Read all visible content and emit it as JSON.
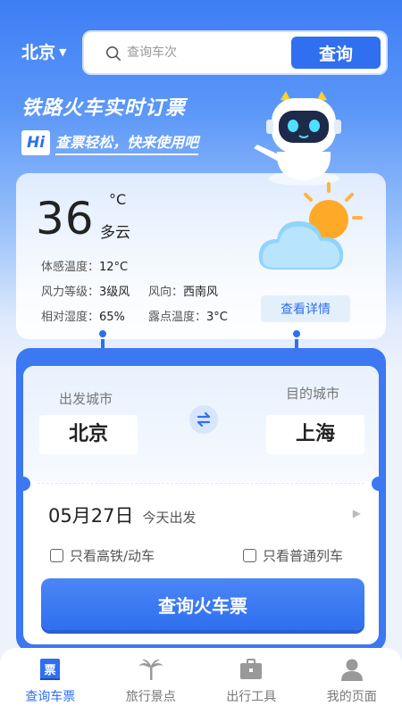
{
  "header": {
    "city": "北京",
    "search_placeholder": "查询车次",
    "search_button": "查询"
  },
  "banner": {
    "title": "铁路火车实时订票",
    "hi": "Hi",
    "subtitle": "查票轻松，快来使用吧"
  },
  "weather": {
    "temperature": "36",
    "unit": "°C",
    "condition": "多云",
    "feels_like_label": "体感温度：",
    "feels_like": "12°C",
    "wind_level_label": "风力等级：",
    "wind_level": "3级风",
    "wind_dir_label": "风向：",
    "wind_dir": "西南风",
    "humidity_label": "相对湿度：",
    "humidity": "65%",
    "dew_label": "露点温度：",
    "dew": "3°C",
    "detail_button": "查看详情"
  },
  "ticket": {
    "from_label": "出发城市",
    "to_label": "目的城市",
    "from_city": "北京",
    "to_city": "上海",
    "date": "05月27日",
    "date_sub": "今天出发",
    "only_high_speed": "只看高铁/动车",
    "only_regular": "只看普通列车",
    "query_button": "查询火车票"
  },
  "nav": [
    {
      "label": "查询车票",
      "icon": "ticket-icon",
      "active": true
    },
    {
      "label": "旅行景点",
      "icon": "palm-tree-icon",
      "active": false
    },
    {
      "label": "出行工具",
      "icon": "briefcase-icon",
      "active": false
    },
    {
      "label": "我的页面",
      "icon": "user-icon",
      "active": false
    }
  ],
  "colors": {
    "primary": "#2f6ff0",
    "text": "#222222"
  }
}
